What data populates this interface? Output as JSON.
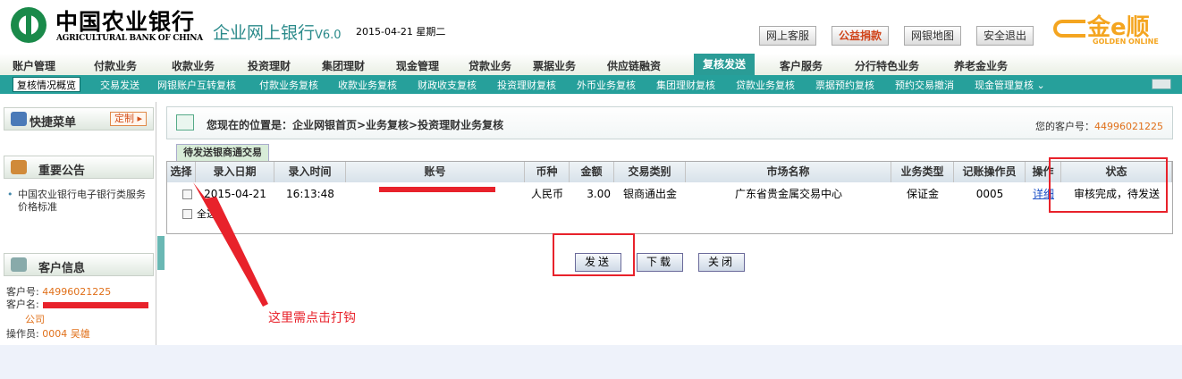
{
  "bank": {
    "name_cn": "中国农业银行",
    "name_en": "AGRICULTURAL BANK OF CHINA",
    "system": "企业网上银行",
    "version": "V6.0",
    "date": "2015-04-21 星期二"
  },
  "top_buttons": [
    "网上客服",
    "公益捐款",
    "网银地图",
    "安全退出"
  ],
  "golden": {
    "text": "金e顺",
    "sub": "GOLDEN ONLINE"
  },
  "menu1": [
    "账户管理",
    "付款业务",
    "收款业务",
    "投资理财",
    "集团理财",
    "现金管理",
    "贷款业务",
    "票据业务",
    "供应链融资",
    "复核发送",
    "客户服务",
    "分行特色业务",
    "养老金业务"
  ],
  "menu2": [
    "复核情况概览",
    "交易发送",
    "网银账户互转复核",
    "付款业务复核",
    "收款业务复核",
    "财政收支复核",
    "投资理财复核",
    "外币业务复核",
    "集团理财复核",
    "贷款业务复核",
    "票据预约复核",
    "预约交易撤消",
    "现金管理复核 ⌄"
  ],
  "sidebar": {
    "quick_menu": "快捷菜单",
    "customize": "定制 ▸",
    "notice_title": "重要公告",
    "notice_item": "中国农业银行电子银行类服务价格标准",
    "customer_title": "客户信息",
    "customer_no_label": "客户号:",
    "customer_no": "44996021225",
    "customer_name_label": "客户名:",
    "customer_name_tail": "公司",
    "operator_label": "操作员:",
    "operator": "0004 吴雄"
  },
  "main": {
    "breadcrumb": "您现在的位置是：企业网银首页>业务复核>投资理财业务复核",
    "cust_no_label": "您的客户号：",
    "cust_no": "44996021225",
    "tab": "待发送银商通交易",
    "columns": [
      "选择",
      "录入日期",
      "录入时间",
      "账号",
      "币种",
      "金额",
      "交易类别",
      "市场名称",
      "业务类型",
      "记账操作员",
      "操作",
      "状态"
    ],
    "row": {
      "date": "2015-04-21",
      "time": "16:13:48",
      "currency": "人民币",
      "amount": "3.00",
      "type": "银商通出金",
      "market": "广东省贵金属交易中心",
      "biz": "保证金",
      "operator": "0005",
      "action": "详细",
      "status": "审核完成，待发送"
    },
    "select_all": "全选",
    "buttons": [
      "发送",
      "下载",
      "关闭"
    ]
  },
  "annotation": "这里需点击打钩",
  "colors": {
    "accent": "#26a09b",
    "red": "#e8222b",
    "link": "#1a4fc6"
  }
}
